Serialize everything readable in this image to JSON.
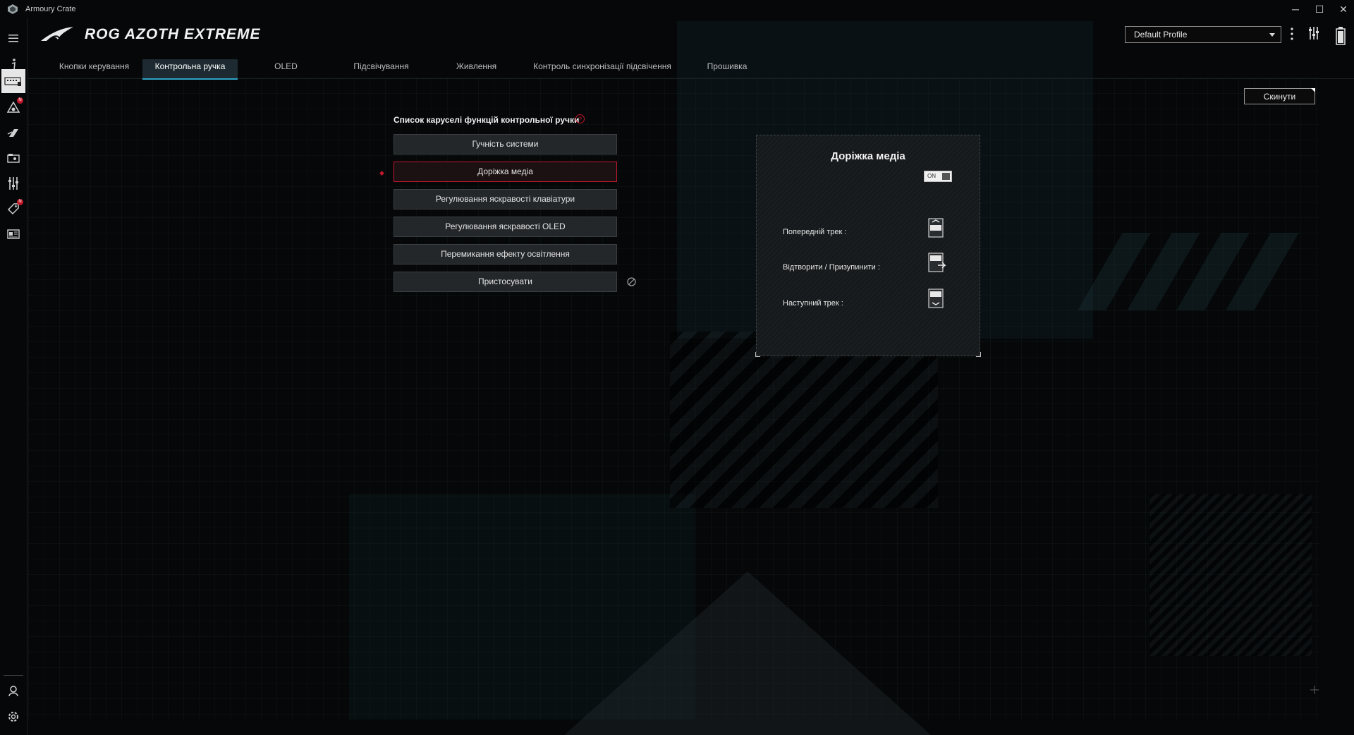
{
  "window": {
    "title": "Armoury Crate",
    "minimize": "─",
    "maximize": "☐",
    "close": "✕"
  },
  "sidebar": {
    "items": [
      {
        "name": "menu",
        "icon": "hamburger-icon"
      },
      {
        "name": "info",
        "icon": "info-icon"
      },
      {
        "name": "device",
        "icon": "keyboard-device-icon",
        "active": true
      },
      {
        "name": "aura-sync",
        "icon": "aura-sync-icon",
        "badge": "N"
      },
      {
        "name": "gamevisual",
        "icon": "gamevisual-icon"
      },
      {
        "name": "gamelibrary",
        "icon": "game-library-icon"
      },
      {
        "name": "settings-tuning",
        "icon": "sliders-icon"
      },
      {
        "name": "deals",
        "icon": "tag-icon",
        "badge": "N"
      },
      {
        "name": "news",
        "icon": "news-icon"
      },
      {
        "name": "user-center",
        "icon": "user-center-icon"
      },
      {
        "name": "settings",
        "icon": "gear-icon"
      }
    ]
  },
  "header": {
    "logo": "rog-logo-icon",
    "product": "ROG AZOTH EXTREME",
    "profile": "Default Profile"
  },
  "tabs": [
    {
      "label": "Кнопки керування"
    },
    {
      "label": "Контрольна ручка",
      "active": true
    },
    {
      "label": "OLED"
    },
    {
      "label": "Підсвічування"
    },
    {
      "label": "Живлення"
    },
    {
      "label": "Контроль синхронізації підсвічення"
    },
    {
      "label": "Прошивка"
    }
  ],
  "reset_label": "Скинути",
  "carousel": {
    "title": "Список каруселі функцій контрольної ручки",
    "help": "?",
    "items": [
      {
        "label": "Гучність системи"
      },
      {
        "label": "Доріжка медіа",
        "selected": true
      },
      {
        "label": "Регулювання яскравості клавіатури"
      },
      {
        "label": "Регулювання яскравості OLED"
      },
      {
        "label": "Перемикання ефекту освітлення"
      },
      {
        "label": "Пристосувати"
      }
    ]
  },
  "detail": {
    "title": "Доріжка медіа",
    "toggle": "ON",
    "rows": [
      {
        "label": "Попередній трек :"
      },
      {
        "label": "Відтворити / Призупинити :"
      },
      {
        "label": "Наступний трек :"
      }
    ]
  },
  "colors": {
    "accent": "#c2182b",
    "tab_underline": "#2ea4c8",
    "background": "#050708"
  }
}
